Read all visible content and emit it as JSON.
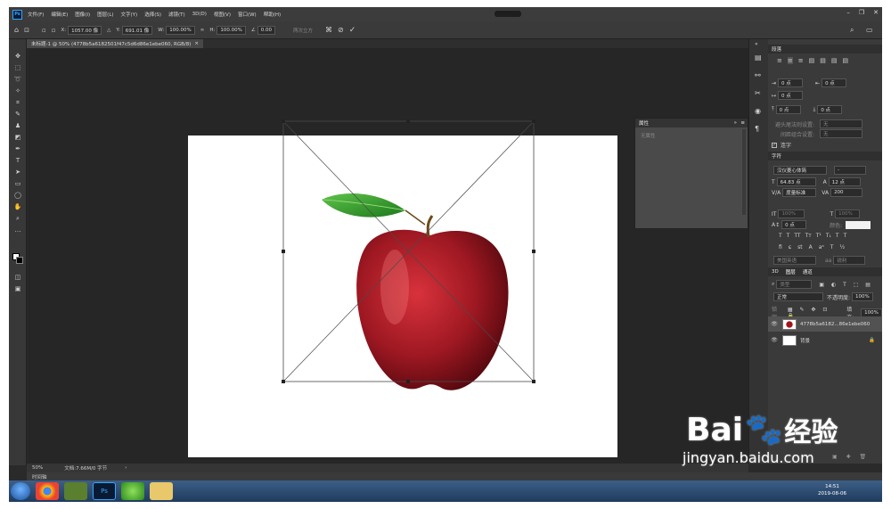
{
  "menu": {
    "logo": "Ps",
    "items": [
      "文件(F)",
      "编辑(E)",
      "图像(I)",
      "图层(L)",
      "文字(Y)",
      "选择(S)",
      "滤镜(T)",
      "3D(D)",
      "视图(V)",
      "窗口(W)",
      "帮助(H)"
    ]
  },
  "options": {
    "x_label": "X:",
    "x_value": "1057.00 像",
    "y_label": "Y:",
    "y_value": "691.01 像",
    "w_label": "W:",
    "w_value": "100.00%",
    "h_label": "H:",
    "h_value": "100.00%",
    "angle_value": "0.00",
    "interp_label": "两次立方"
  },
  "document": {
    "tab_title": "未标题-1 @ 50% (4778b5a6182501f47c5d6d86e1ebe060, RGB/8)",
    "zoom": "50%",
    "doc_info": "文档:7.66M/0 字节"
  },
  "timeline": {
    "label": "时间轴"
  },
  "properties_panel": {
    "title": "属性",
    "empty_text": "无属性"
  },
  "paragraph_panel": {
    "title": "段落",
    "indent_values": [
      "0 点",
      "0 点",
      "0 点",
      "0 点",
      "0 点"
    ],
    "avoid_label": "避头尾法则设置:",
    "avoid_value": "无",
    "spacing_label": "间距组合设置:",
    "spacing_value": "无",
    "hyphen_label": "连字"
  },
  "character_panel": {
    "title": "字符",
    "font_family": "汉仪菱心体简",
    "font_style": "-",
    "size": "64.83 点",
    "leading": "12 点",
    "kerning": "度量标准",
    "tracking": "200",
    "scale_v": "100%",
    "scale_h": "100%",
    "baseline": "0 点",
    "color_label": "颜色:",
    "aa_label": "美国英语",
    "aa_mode": "锐利"
  },
  "layers_panel": {
    "tabs": [
      "3D",
      "图层",
      "通道"
    ],
    "filter_label": "类型",
    "blend_mode": "正常",
    "opacity_label": "不透明度:",
    "opacity_value": "100%",
    "lock_label": "锁定:",
    "fill_label": "填充:",
    "fill_value": "100%",
    "layers": [
      {
        "name": "4778b5a6182...86e1ebe060"
      },
      {
        "name": "背景"
      }
    ]
  },
  "taskbar": {
    "time": "14:51",
    "date": "2019-08-06"
  },
  "watermark": {
    "brand": "Bai",
    "brand_cn": "经验",
    "url": "jingyan.baidu.com"
  }
}
